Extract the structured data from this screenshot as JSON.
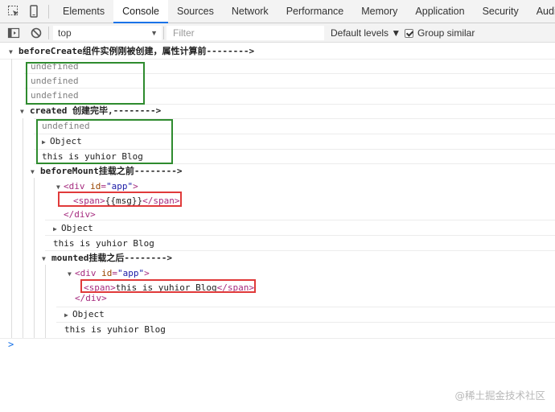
{
  "devtools": {
    "tabs": [
      "Elements",
      "Console",
      "Sources",
      "Network",
      "Performance",
      "Memory",
      "Application",
      "Security",
      "Audits"
    ],
    "active_tab": "Console"
  },
  "toolbar": {
    "context": "top",
    "filter_placeholder": "Filter",
    "levels": "Default levels ▼",
    "group_similar": "Group similar",
    "group_similar_checked": true
  },
  "log": {
    "before_create_header": "beforeCreate组件实例刚被创建，属性计算前-------->",
    "bc_values": [
      "undefined",
      "undefined",
      "undefined"
    ],
    "created_header": "created 创建完毕,-------->",
    "created_undefined": "undefined",
    "created_object": "Object",
    "created_message": "this is yuhior Blog",
    "before_mount_header": "beforeMount挂载之前-------->",
    "bm_div_open_tag": "div",
    "bm_div_attr": "id",
    "bm_div_attr_value": "\"app\"",
    "bm_span_content": "{{msg}}",
    "bm_div_close": "</div>",
    "bm_object": "Object",
    "bm_message": "this is yuhior Blog",
    "mounted_header": "mounted挂载之后-------->",
    "m_div_open_tag": "div",
    "m_div_attr": "id",
    "m_div_attr_value": "\"app\"",
    "m_span_content": "this is yuhior Blog",
    "m_div_close": "</div>",
    "m_object": "Object",
    "m_message": "this is yuhior Blog",
    "prompt": ">"
  },
  "watermark": "@稀土掘金技术社区",
  "colors": {
    "green_box": "#2e8b2e",
    "red_box": "#e03a3a",
    "tab_underline": "#1a73e8"
  }
}
